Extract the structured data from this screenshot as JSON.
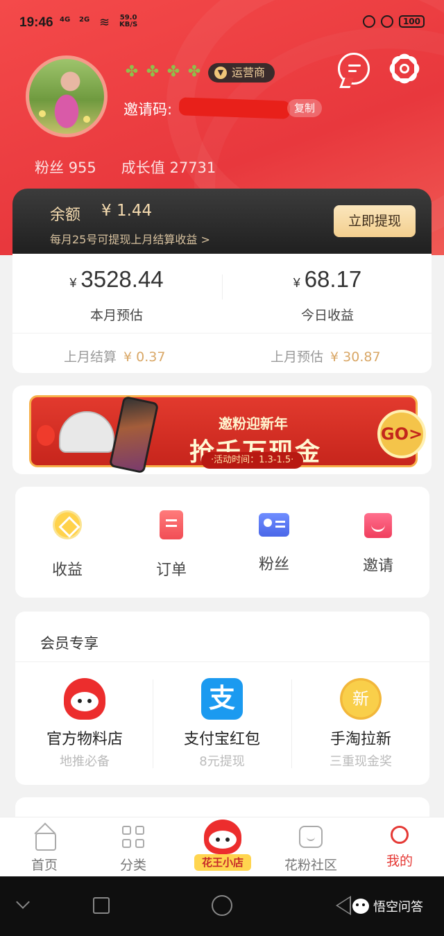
{
  "status_bar": {
    "time": "19:46",
    "signal1": "4G",
    "signal2": "2G",
    "net_speed_value": "59.0",
    "net_speed_unit": "KB/S",
    "battery": "100"
  },
  "profile": {
    "level_icons": [
      "clover-icon",
      "clover-icon",
      "clover-icon",
      "clover-icon"
    ],
    "role_badge": "运营商",
    "invite_label": "邀请码:",
    "copy_label": "复制",
    "fans_label": "粉丝",
    "fans_count": "955",
    "growth_label": "成长值",
    "growth_value": "27731"
  },
  "balance": {
    "label": "余额",
    "amount": "¥ 1.44",
    "note": "每月25号可提现上月结算收益",
    "note_chevron": ">",
    "withdraw_label": "立即提现"
  },
  "earnings": {
    "currency": "¥",
    "month_estimate_value": "3528.44",
    "month_estimate_label": "本月预估",
    "today_value": "68.17",
    "today_label": "今日收益",
    "last_settled_label": "上月结算",
    "last_settled_value": "¥ 0.37",
    "last_estimate_label": "上月预估",
    "last_estimate_value": "¥ 30.87"
  },
  "banner": {
    "line1": "邀粉迎新年",
    "line2": "抢千万现金",
    "period": "·活动时间：1.3-1.5·",
    "go": "GO>"
  },
  "quick_menu": [
    {
      "label": "收益",
      "icon": "earnings-icon"
    },
    {
      "label": "订单",
      "icon": "order-icon"
    },
    {
      "label": "粉丝",
      "icon": "fans-icon"
    },
    {
      "label": "邀请",
      "icon": "invite-gift-icon"
    }
  ],
  "member": {
    "title": "会员专享",
    "items": [
      {
        "name": "官方物料店",
        "sub": "地推必备",
        "icon": "mascot-icon"
      },
      {
        "name": "支付宝红包",
        "sub": "8元提现",
        "icon_text": "支",
        "icon": "alipay-icon"
      },
      {
        "name": "手淘拉新",
        "sub": "三重现金奖",
        "icon_text": "新",
        "icon": "new-coin-icon"
      }
    ]
  },
  "tabbar": {
    "home": "首页",
    "category": "分类",
    "shop": "花王小店",
    "community": "花粉社区",
    "mine": "我的"
  },
  "watermark": "悟空问答",
  "colors": {
    "header_red": "#ee4242",
    "accent_gold": "#f6dcb0",
    "active_tab": "#e53935"
  }
}
